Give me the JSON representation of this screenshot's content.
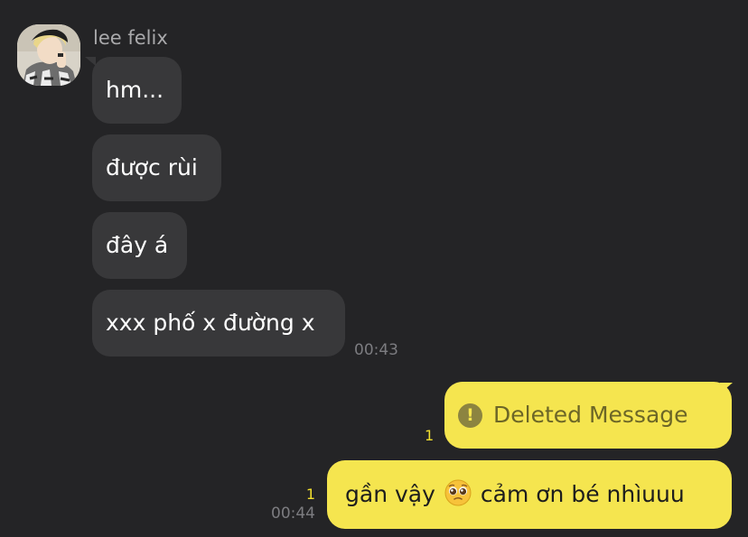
{
  "sender": {
    "name": "lee felix"
  },
  "incoming_messages": [
    {
      "text": "hm..."
    },
    {
      "text": "được rùi"
    },
    {
      "text": "đây á"
    },
    {
      "text": "xxx phố x đường x",
      "time": "00:43"
    }
  ],
  "outgoing_messages": [
    {
      "text": "Deleted Message",
      "type": "deleted",
      "unread_count": "1",
      "icon": "exclamation-circle-icon"
    },
    {
      "text_before": "gần vậy",
      "emoji": "pleading-face-emoji",
      "text_after": "cảm ơn bé nhìuuu",
      "unread_count": "1",
      "time": "00:44"
    }
  ],
  "colors": {
    "background": "#242426",
    "incoming_bubble": "#38383a",
    "outgoing_bubble": "#f5e54f",
    "unread_count": "#f2df2e",
    "timestamp": "#7c7c80"
  }
}
